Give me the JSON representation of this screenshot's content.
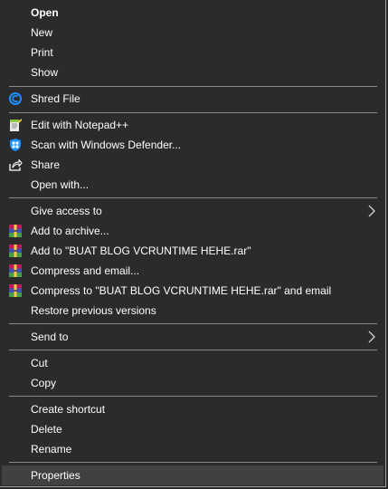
{
  "menu": {
    "items": [
      {
        "label": "Open"
      },
      {
        "label": "New"
      },
      {
        "label": "Print"
      },
      {
        "label": "Show"
      },
      {
        "label": "Shred File",
        "icon": "shred-file-icon"
      },
      {
        "label": "Edit with Notepad++",
        "icon": "notepad-plus-plus-icon"
      },
      {
        "label": "Scan with Windows Defender...",
        "icon": "windows-defender-icon"
      },
      {
        "label": "Share",
        "icon": "share-icon"
      },
      {
        "label": "Open with..."
      },
      {
        "label": "Give access to",
        "submenu": true
      },
      {
        "label": "Add to archive...",
        "icon": "winrar-icon"
      },
      {
        "label": "Add to \"BUAT BLOG VCRUNTIME HEHE.rar\"",
        "icon": "winrar-icon"
      },
      {
        "label": "Compress and email...",
        "icon": "winrar-icon"
      },
      {
        "label": "Compress to \"BUAT BLOG VCRUNTIME HEHE.rar\" and email",
        "icon": "winrar-icon"
      },
      {
        "label": "Restore previous versions"
      },
      {
        "label": "Send to",
        "submenu": true
      },
      {
        "label": "Cut"
      },
      {
        "label": "Copy"
      },
      {
        "label": "Create shortcut"
      },
      {
        "label": "Delete"
      },
      {
        "label": "Rename"
      },
      {
        "label": "Properties",
        "highlighted": true
      }
    ]
  },
  "colors": {
    "background": "#2b2b2b",
    "text": "#ffffff",
    "separator": "#8a8a8a",
    "hover": "#414141",
    "accent": "#1e90ff"
  }
}
